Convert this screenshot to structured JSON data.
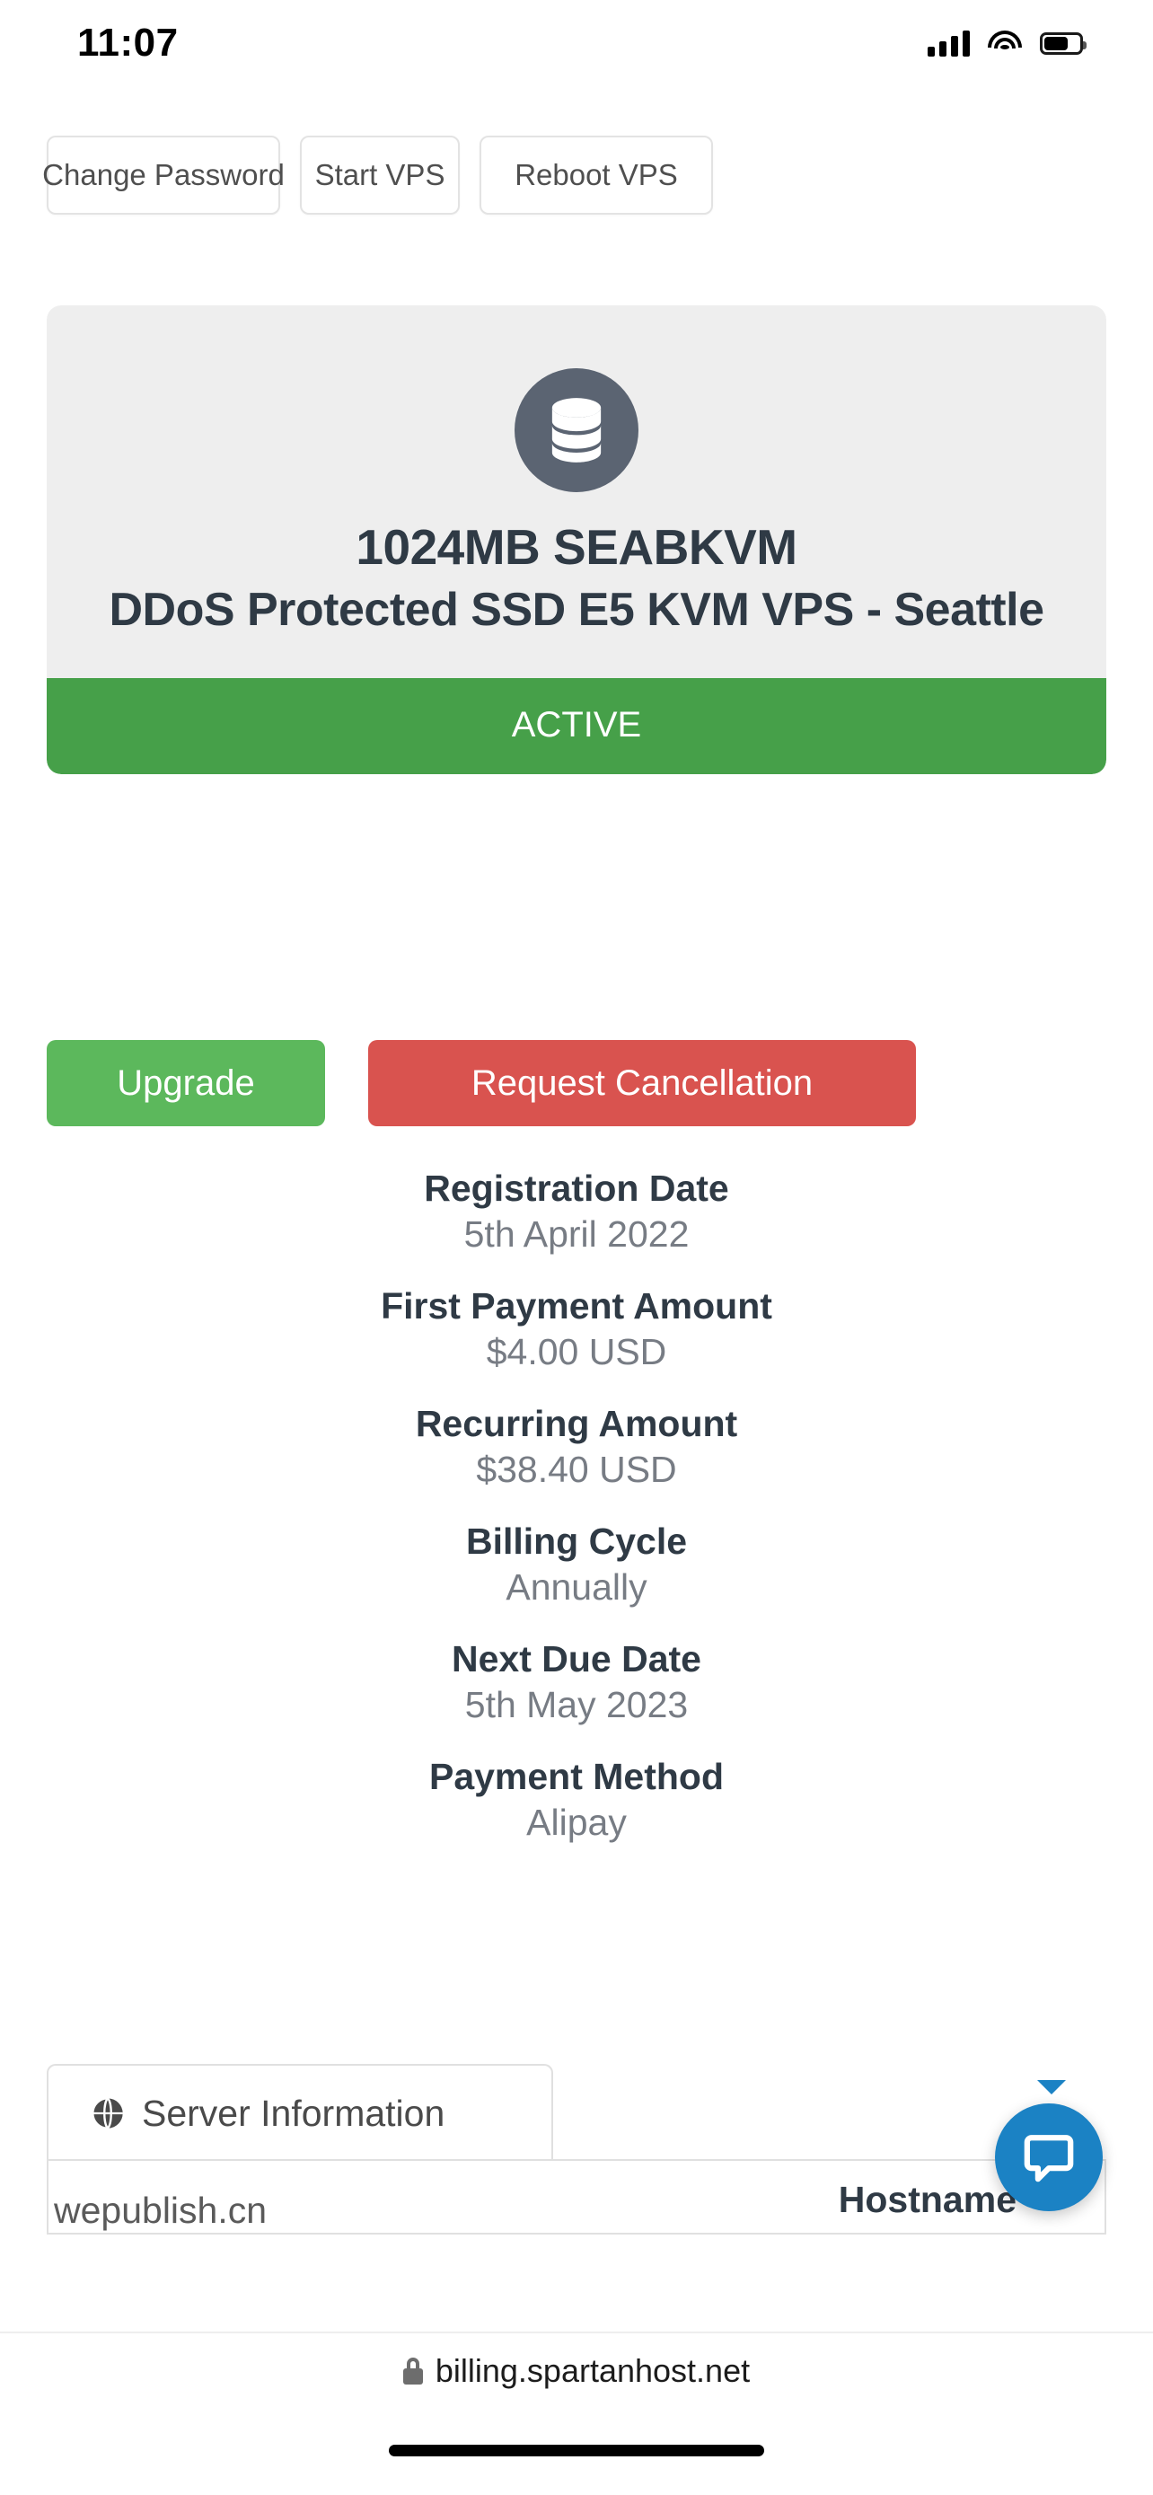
{
  "statusbar": {
    "time": "11:07",
    "signal_icon": "cellular-signal-icon",
    "wifi_icon": "wifi-icon",
    "battery_icon": "battery-icon"
  },
  "actions": [
    {
      "label": "Change Password",
      "name": "change-password-button"
    },
    {
      "label": "Start VPS",
      "name": "start-vps-button"
    },
    {
      "label": "Reboot VPS",
      "name": "reboot-vps-button"
    }
  ],
  "product": {
    "icon": "database-icon",
    "icon_bg": "#5b6472",
    "title": "1024MB SEABKVM",
    "subtitle": "DDoS Protected SSD E5 KVM VPS - Seattle",
    "status": "ACTIVE",
    "status_color": "#46a049"
  },
  "cta": {
    "upgrade_label": "Upgrade",
    "upgrade_color": "#5cb85c",
    "cancel_label": "Request Cancellation",
    "cancel_color": "#d9534f"
  },
  "details": [
    {
      "label": "Registration Date",
      "value": "5th April 2022"
    },
    {
      "label": "First Payment Amount",
      "value": "$4.00 USD"
    },
    {
      "label": "Recurring Amount",
      "value": "$38.40 USD"
    },
    {
      "label": "Billing Cycle",
      "value": "Annually"
    },
    {
      "label": "Next Due Date",
      "value": "5th May 2023"
    },
    {
      "label": "Payment Method",
      "value": "Alipay"
    }
  ],
  "panel": {
    "tab_icon": "globe-icon",
    "tab_label": "Server Information",
    "hostname_label": "Hostname",
    "hostname_value": "wepublish.cn"
  },
  "chat": {
    "icon": "chat-bubble-icon",
    "color": "#1b82c4"
  },
  "browser": {
    "lock_icon": "lock-icon",
    "url": "billing.spartanhost.net"
  }
}
